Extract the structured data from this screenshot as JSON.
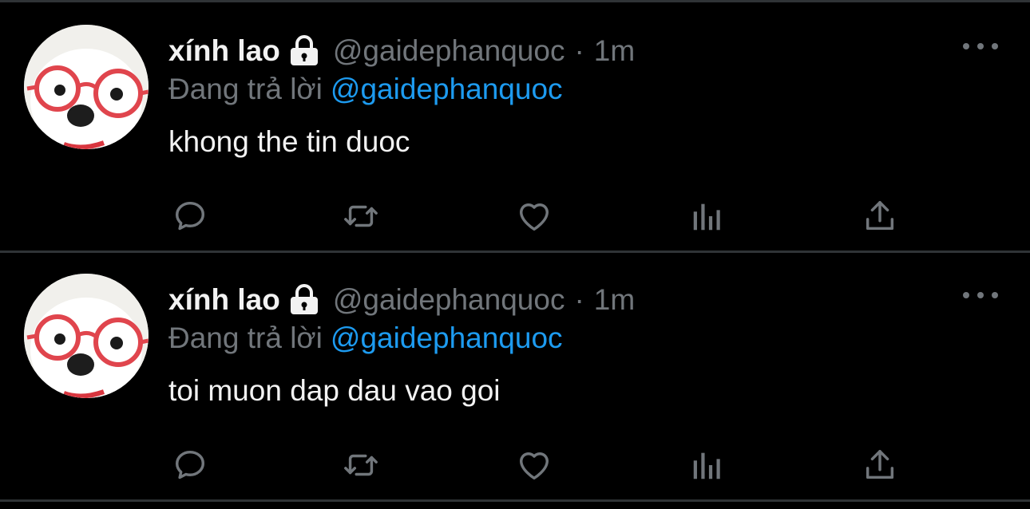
{
  "colors": {
    "background": "#000000",
    "divider": "#2f3336",
    "muted": "#71767b",
    "link": "#1d9bf0",
    "text": "#f2f2f2"
  },
  "tweets": [
    {
      "display_name": "xính lao",
      "protected_icon": "lock-icon",
      "handle": "@gaidephanquoc",
      "separator": "·",
      "time": "1m",
      "reply_prefix": "Đang trả lời",
      "reply_to": "@gaidephanquoc",
      "text": "khong the tin duoc",
      "actions": [
        "reply-icon",
        "retweet-icon",
        "like-icon",
        "analytics-icon",
        "share-icon"
      ]
    },
    {
      "display_name": "xính lao",
      "protected_icon": "lock-icon",
      "handle": "@gaidephanquoc",
      "separator": "·",
      "time": "1m",
      "reply_prefix": "Đang trả lời",
      "reply_to": "@gaidephanquoc",
      "text": "toi muon dap dau vao goi",
      "actions": [
        "reply-icon",
        "retweet-icon",
        "like-icon",
        "analytics-icon",
        "share-icon"
      ]
    }
  ]
}
